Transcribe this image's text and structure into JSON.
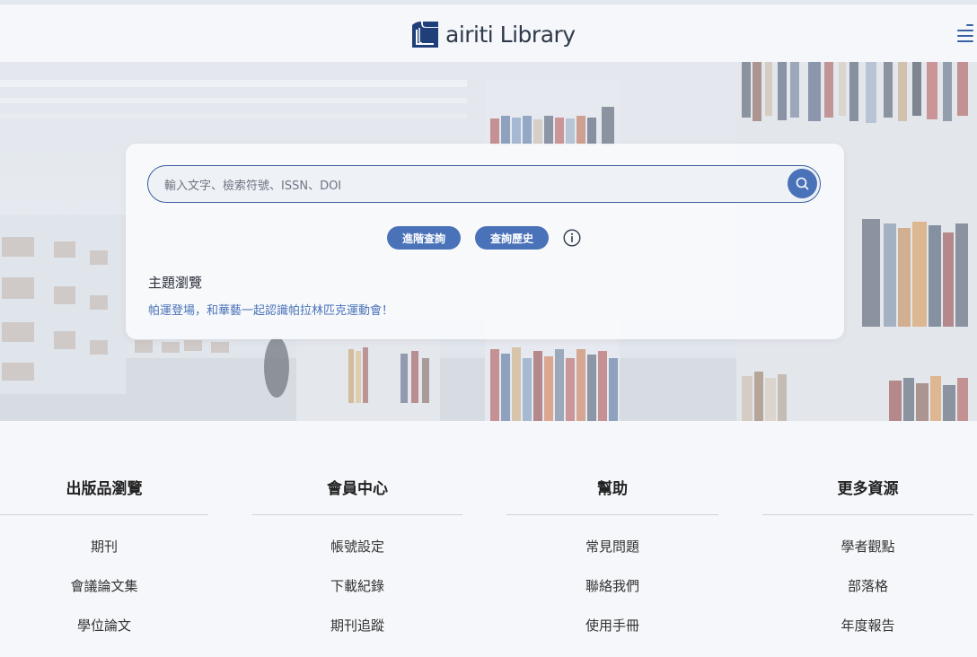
{
  "header": {
    "brand_name": "airiti Library"
  },
  "search": {
    "placeholder": "輸入文字、檢索符號、ISSN、DOI",
    "value": "",
    "advanced_label": "進階查詢",
    "history_label": "查詢歷史"
  },
  "topic": {
    "title": "主題瀏覽",
    "link": "帕運登場，和華藝一起認識帕拉林匹克運動會！"
  },
  "footer": {
    "columns": [
      {
        "title": "出版品瀏覽",
        "links": [
          "期刊",
          "會議論文集",
          "學位論文"
        ]
      },
      {
        "title": "會員中心",
        "links": [
          "帳號設定",
          "下載紀錄",
          "期刊追蹤"
        ]
      },
      {
        "title": "幫助",
        "links": [
          "常見問題",
          "聯絡我們",
          "使用手冊"
        ]
      },
      {
        "title": "更多資源",
        "links": [
          "學者觀點",
          "部落格",
          "年度報告"
        ]
      }
    ]
  },
  "colors": {
    "accent": "#4a72b8",
    "brand_dark": "#1f3f7a",
    "text": "#222222",
    "background": "#f5f7fa"
  },
  "icons": {
    "search": "search-icon",
    "info": "info-icon",
    "menu": "hamburger-menu-icon",
    "logo": "book-logo-icon"
  }
}
